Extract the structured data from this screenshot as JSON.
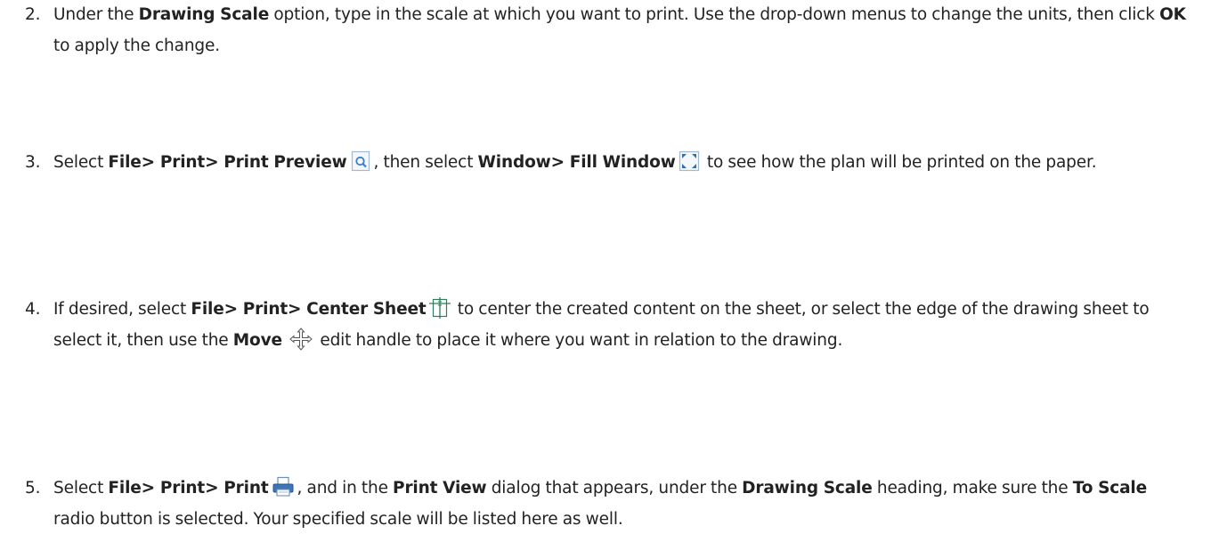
{
  "steps": [
    {
      "number": "2.",
      "parts": {
        "a": "Under the ",
        "b": "Drawing Scale",
        "c": " option, type in the scale at which you want to print. Use the drop-down menus to change the units, then click ",
        "d": "OK",
        "e": " to apply the change."
      }
    },
    {
      "number": "3.",
      "parts": {
        "a": "Select ",
        "b": "File> Print> Print Preview",
        "c": ", then select ",
        "d": "Window> Fill Window",
        "e": " to see how the plan will be printed on the paper."
      },
      "icons": [
        "print-preview-icon",
        "fill-window-icon"
      ]
    },
    {
      "number": "4.",
      "parts": {
        "a": "If desired, select ",
        "b": "File> Print> Center Sheet",
        "c": " to center the created content on the sheet, or select the edge of the drawing sheet to select it, then use the ",
        "d": "Move",
        "e": " edit handle to place it where you want in relation to the drawing."
      },
      "icons": [
        "center-sheet-icon",
        "move-handle-icon"
      ]
    },
    {
      "number": "5.",
      "parts": {
        "a": "Select ",
        "b": "File> Print> Print",
        "c": ", and in the ",
        "d": "Print View",
        "e": " dialog that appears, under the ",
        "f": "Drawing Scale",
        "g": " heading, make sure the ",
        "h": "To Scale",
        "i": " radio button is selected. Your specified scale will be listed here as well."
      },
      "icons": [
        "printer-icon"
      ]
    }
  ],
  "colors": {
    "text": "#222222",
    "icon_blue": "#3b7fc4",
    "icon_frame": "#9fb8d3"
  }
}
